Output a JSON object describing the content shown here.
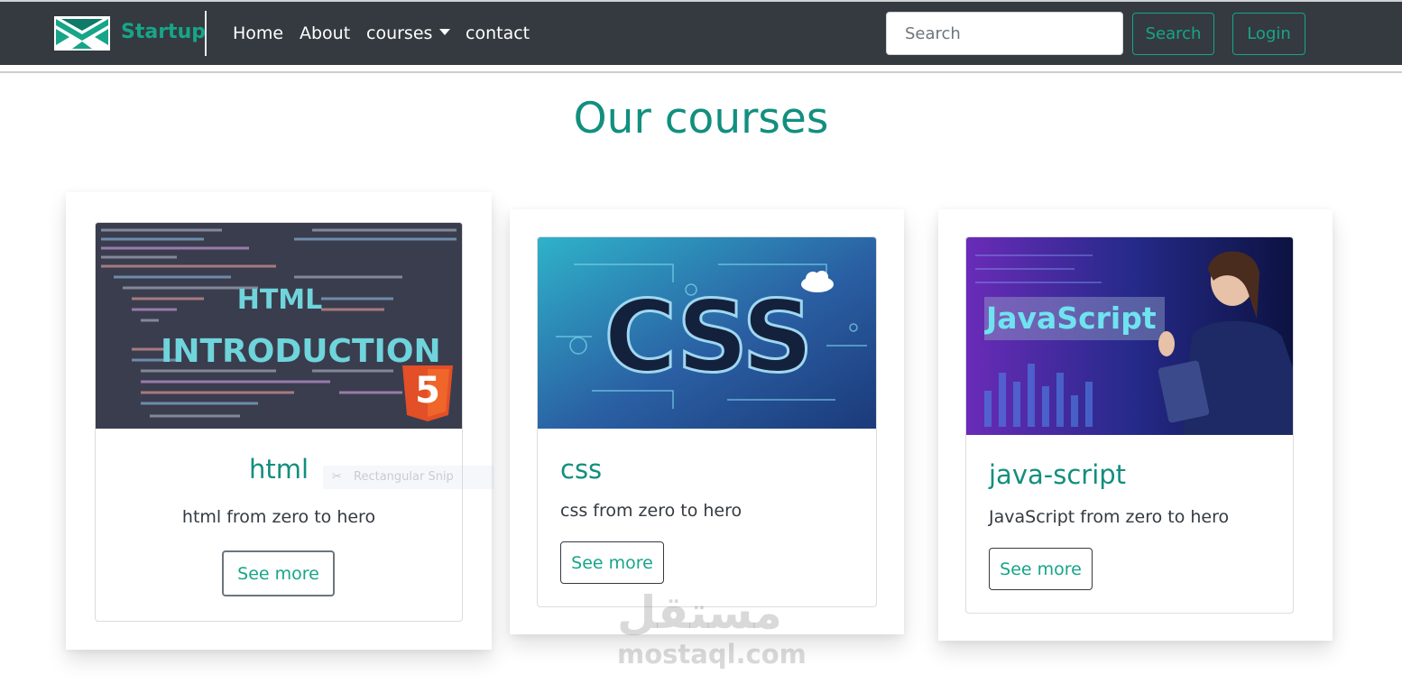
{
  "navbar": {
    "brand": "Startup",
    "links": [
      "Home",
      "About",
      "courses",
      "contact"
    ],
    "search_placeholder": "Search",
    "search_button": "Search",
    "login_button": "Login"
  },
  "title": "Our courses",
  "courses": [
    {
      "image_caption": [
        "HTML",
        "INTRODUCTION"
      ],
      "image_badge": "5",
      "title": "html",
      "text": "html from zero to hero",
      "button": "See more"
    },
    {
      "image_caption": [
        "CSS"
      ],
      "title": "css",
      "text": "css from zero to hero",
      "button": "See more"
    },
    {
      "image_caption": [
        "JavaScript"
      ],
      "title": "java-script",
      "text": "JavaScript from zero to hero",
      "button": "See more"
    }
  ],
  "overlay": {
    "snip_label": "Rectangular Snip"
  },
  "watermark": {
    "arabic": "مستقل",
    "latin": "mostaql.com"
  },
  "colors": {
    "navbar_bg": "#343a40",
    "accent": "#17a589",
    "heading": "#128f7e"
  }
}
